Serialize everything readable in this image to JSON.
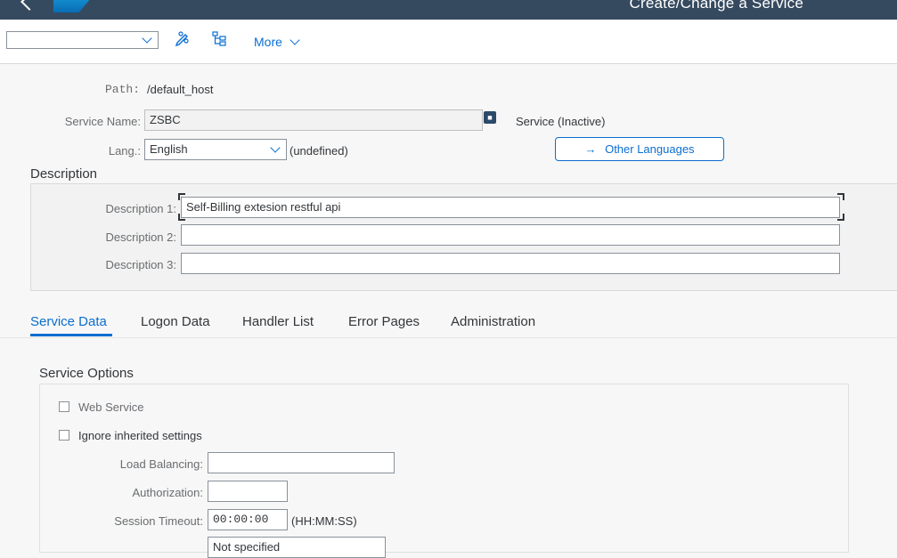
{
  "shell": {
    "title": "Create/Change a Service"
  },
  "toolbar": {
    "select_value": "",
    "edit_icon": "pencil-glasses-icon",
    "hierarchy_icon": "hierarchy-icon",
    "more_label": "More"
  },
  "header": {
    "path_label": "Path:",
    "path_value": "/default_host",
    "service_name_label": "Service Name:",
    "service_name_value": "ZSBC",
    "service_status": "Service (Inactive)",
    "lang_label": "Lang.:",
    "lang_value": "English",
    "lang_note": "(undefined)",
    "other_languages_button": "Other Languages",
    "other_languages_arrow": "→"
  },
  "description": {
    "title": "Description",
    "fields": [
      {
        "label": "Description 1:",
        "value": "Self-Billing extesion restful api"
      },
      {
        "label": "Description 2:",
        "value": ""
      },
      {
        "label": "Description 3:",
        "value": ""
      }
    ]
  },
  "tabs": [
    {
      "label": "Service Data",
      "active": true
    },
    {
      "label": "Logon Data",
      "active": false
    },
    {
      "label": "Handler List",
      "active": false
    },
    {
      "label": "Error Pages",
      "active": false
    },
    {
      "label": "Administration",
      "active": false
    }
  ],
  "service_options": {
    "title": "Service Options",
    "web_service_label": "Web Service",
    "web_service_checked": false,
    "ignore_inherited_label": "Ignore inherited settings",
    "ignore_inherited_checked": false,
    "load_balancing_label": "Load Balancing:",
    "load_balancing_value": "",
    "authorization_label": "Authorization:",
    "authorization_value": "",
    "session_timeout_label": "Session Timeout:",
    "session_timeout_value": "00:00:00",
    "session_timeout_format": "(HH:MM:SS)",
    "compression_value": "Not specified"
  },
  "colors": {
    "shell": "#354a5f",
    "accent": "#0a6ed1",
    "background": "#f7f7f7"
  }
}
